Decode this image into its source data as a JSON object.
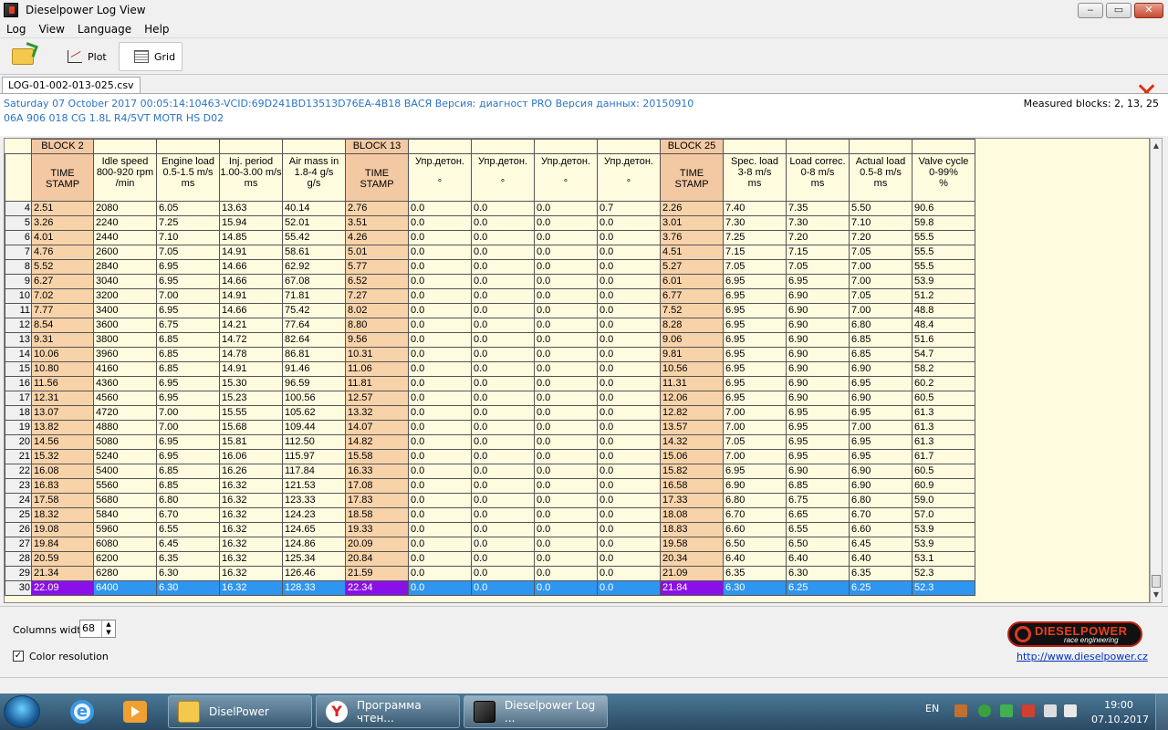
{
  "window": {
    "title": "Dieselpower Log View",
    "min_label": "‒",
    "max_label": "▭",
    "close_label": "✕"
  },
  "menu": [
    "Log",
    "View",
    "Language",
    "Help"
  ],
  "toolbar": {
    "plot_label": "Plot",
    "grid_label": "Grid"
  },
  "file_tab": "LOG-01-002-013-025.csv",
  "info": {
    "line1": "Saturday 07 October 2017 00:05:14:10463-VCID:69D241BD13513D76EA-4B18 ВАСЯ Версия: диагност PRO Версия данных: 20150910",
    "line2": "06A 906 018 CG  1.8L R4/5VT MOTR HS D02",
    "measured": "Measured blocks: 2, 13, 25"
  },
  "grid": {
    "blocks": [
      {
        "label": "BLOCK 2",
        "span": 5
      },
      {
        "label": "BLOCK 13",
        "span": 5
      },
      {
        "label": "BLOCK 25",
        "span": 5
      }
    ],
    "headers": [
      "TIME\nSTAMP",
      "Idle speed\n800-920 rpm\n/min",
      "Engine load\n0.5-1.5 m/s\nms",
      "Inj. period\n1.00-3.00 m/s\nms",
      "Air mass in\n1.8-4 g/s\ng/s",
      "TIME\nSTAMP",
      "Упр.детон.\n\n°",
      "Упр.детон.\n\n°",
      "Упр.детон.\n\n°",
      "Упр.детон.\n\n°",
      "TIME\nSTAMP",
      "Spec. load\n3-8 m/s\nms",
      "Load correc.\n0-8 m/s\nms",
      "Actual load\n0.5-8 m/s\nms",
      "Valve cycle\n0-99%\n%"
    ],
    "timestamp_cols": [
      0,
      5,
      10
    ],
    "selected_row": 30,
    "rows": [
      {
        "n": "4",
        "cells": [
          "2.51",
          "2080",
          "6.05",
          "13.63",
          "40.14",
          "2.76",
          "0.0",
          "0.0",
          "0.0",
          "0.7",
          "2.26",
          "7.40",
          "7.35",
          "5.50",
          "90.6"
        ]
      },
      {
        "n": "5",
        "cells": [
          "3.26",
          "2240",
          "7.25",
          "15.94",
          "52.01",
          "3.51",
          "0.0",
          "0.0",
          "0.0",
          "0.0",
          "3.01",
          "7.30",
          "7.30",
          "7.10",
          "59.8"
        ]
      },
      {
        "n": "6",
        "cells": [
          "4.01",
          "2440",
          "7.10",
          "14.85",
          "55.42",
          "4.26",
          "0.0",
          "0.0",
          "0.0",
          "0.0",
          "3.76",
          "7.25",
          "7.20",
          "7.20",
          "55.5"
        ]
      },
      {
        "n": "7",
        "cells": [
          "4.76",
          "2600",
          "7.05",
          "14.91",
          "58.61",
          "5.01",
          "0.0",
          "0.0",
          "0.0",
          "0.0",
          "4.51",
          "7.15",
          "7.15",
          "7.05",
          "55.5"
        ]
      },
      {
        "n": "8",
        "cells": [
          "5.52",
          "2840",
          "6.95",
          "14.66",
          "62.92",
          "5.77",
          "0.0",
          "0.0",
          "0.0",
          "0.0",
          "5.27",
          "7.05",
          "7.05",
          "7.00",
          "55.5"
        ]
      },
      {
        "n": "9",
        "cells": [
          "6.27",
          "3040",
          "6.95",
          "14.66",
          "67.08",
          "6.52",
          "0.0",
          "0.0",
          "0.0",
          "0.0",
          "6.01",
          "6.95",
          "6.95",
          "7.00",
          "53.9"
        ]
      },
      {
        "n": "10",
        "cells": [
          "7.02",
          "3200",
          "7.00",
          "14.91",
          "71.81",
          "7.27",
          "0.0",
          "0.0",
          "0.0",
          "0.0",
          "6.77",
          "6.95",
          "6.90",
          "7.05",
          "51.2"
        ]
      },
      {
        "n": "11",
        "cells": [
          "7.77",
          "3400",
          "6.95",
          "14.66",
          "75.42",
          "8.02",
          "0.0",
          "0.0",
          "0.0",
          "0.0",
          "7.52",
          "6.95",
          "6.90",
          "7.00",
          "48.8"
        ]
      },
      {
        "n": "12",
        "cells": [
          "8.54",
          "3600",
          "6.75",
          "14.21",
          "77.64",
          "8.80",
          "0.0",
          "0.0",
          "0.0",
          "0.0",
          "8.28",
          "6.95",
          "6.90",
          "6.80",
          "48.4"
        ]
      },
      {
        "n": "13",
        "cells": [
          "9.31",
          "3800",
          "6.85",
          "14.72",
          "82.64",
          "9.56",
          "0.0",
          "0.0",
          "0.0",
          "0.0",
          "9.06",
          "6.95",
          "6.90",
          "6.85",
          "51.6"
        ]
      },
      {
        "n": "14",
        "cells": [
          "10.06",
          "3960",
          "6.85",
          "14.78",
          "86.81",
          "10.31",
          "0.0",
          "0.0",
          "0.0",
          "0.0",
          "9.81",
          "6.95",
          "6.90",
          "6.85",
          "54.7"
        ]
      },
      {
        "n": "15",
        "cells": [
          "10.80",
          "4160",
          "6.85",
          "14.91",
          "91.46",
          "11.06",
          "0.0",
          "0.0",
          "0.0",
          "0.0",
          "10.56",
          "6.95",
          "6.90",
          "6.90",
          "58.2"
        ]
      },
      {
        "n": "16",
        "cells": [
          "11.56",
          "4360",
          "6.95",
          "15.30",
          "96.59",
          "11.81",
          "0.0",
          "0.0",
          "0.0",
          "0.0",
          "11.31",
          "6.95",
          "6.90",
          "6.95",
          "60.2"
        ]
      },
      {
        "n": "17",
        "cells": [
          "12.31",
          "4560",
          "6.95",
          "15.23",
          "100.56",
          "12.57",
          "0.0",
          "0.0",
          "0.0",
          "0.0",
          "12.06",
          "6.95",
          "6.90",
          "6.90",
          "60.5"
        ]
      },
      {
        "n": "18",
        "cells": [
          "13.07",
          "4720",
          "7.00",
          "15.55",
          "105.62",
          "13.32",
          "0.0",
          "0.0",
          "0.0",
          "0.0",
          "12.82",
          "7.00",
          "6.95",
          "6.95",
          "61.3"
        ]
      },
      {
        "n": "19",
        "cells": [
          "13.82",
          "4880",
          "7.00",
          "15.68",
          "109.44",
          "14.07",
          "0.0",
          "0.0",
          "0.0",
          "0.0",
          "13.57",
          "7.00",
          "6.95",
          "7.00",
          "61.3"
        ]
      },
      {
        "n": "20",
        "cells": [
          "14.56",
          "5080",
          "6.95",
          "15.81",
          "112.50",
          "14.82",
          "0.0",
          "0.0",
          "0.0",
          "0.0",
          "14.32",
          "7.05",
          "6.95",
          "6.95",
          "61.3"
        ]
      },
      {
        "n": "21",
        "cells": [
          "15.32",
          "5240",
          "6.95",
          "16.06",
          "115.97",
          "15.58",
          "0.0",
          "0.0",
          "0.0",
          "0.0",
          "15.06",
          "7.00",
          "6.95",
          "6.95",
          "61.7"
        ]
      },
      {
        "n": "22",
        "cells": [
          "16.08",
          "5400",
          "6.85",
          "16.26",
          "117.84",
          "16.33",
          "0.0",
          "0.0",
          "0.0",
          "0.0",
          "15.82",
          "6.95",
          "6.90",
          "6.90",
          "60.5"
        ]
      },
      {
        "n": "23",
        "cells": [
          "16.83",
          "5560",
          "6.85",
          "16.32",
          "121.53",
          "17.08",
          "0.0",
          "0.0",
          "0.0",
          "0.0",
          "16.58",
          "6.90",
          "6.85",
          "6.90",
          "60.9"
        ]
      },
      {
        "n": "24",
        "cells": [
          "17.58",
          "5680",
          "6.80",
          "16.32",
          "123.33",
          "17.83",
          "0.0",
          "0.0",
          "0.0",
          "0.0",
          "17.33",
          "6.80",
          "6.75",
          "6.80",
          "59.0"
        ]
      },
      {
        "n": "25",
        "cells": [
          "18.32",
          "5840",
          "6.70",
          "16.32",
          "124.23",
          "18.58",
          "0.0",
          "0.0",
          "0.0",
          "0.0",
          "18.08",
          "6.70",
          "6.65",
          "6.70",
          "57.0"
        ]
      },
      {
        "n": "26",
        "cells": [
          "19.08",
          "5960",
          "6.55",
          "16.32",
          "124.65",
          "19.33",
          "0.0",
          "0.0",
          "0.0",
          "0.0",
          "18.83",
          "6.60",
          "6.55",
          "6.60",
          "53.9"
        ]
      },
      {
        "n": "27",
        "cells": [
          "19.84",
          "6080",
          "6.45",
          "16.32",
          "124.86",
          "20.09",
          "0.0",
          "0.0",
          "0.0",
          "0.0",
          "19.58",
          "6.50",
          "6.50",
          "6.45",
          "53.9"
        ]
      },
      {
        "n": "28",
        "cells": [
          "20.59",
          "6200",
          "6.35",
          "16.32",
          "125.34",
          "20.84",
          "0.0",
          "0.0",
          "0.0",
          "0.0",
          "20.34",
          "6.40",
          "6.40",
          "6.40",
          "53.1"
        ]
      },
      {
        "n": "29",
        "cells": [
          "21.34",
          "6280",
          "6.30",
          "16.32",
          "126.46",
          "21.59",
          "0.0",
          "0.0",
          "0.0",
          "0.0",
          "21.09",
          "6.35",
          "6.30",
          "6.35",
          "52.3"
        ]
      },
      {
        "n": "30",
        "cells": [
          "22.09",
          "6400",
          "6.30",
          "16.32",
          "128.33",
          "22.34",
          "0.0",
          "0.0",
          "0.0",
          "0.0",
          "21.84",
          "6.30",
          "6.25",
          "6.25",
          "52.3"
        ]
      }
    ]
  },
  "bottom": {
    "columns_width_label": "Columns width:",
    "columns_width_value": "68",
    "color_resolution_label": "Color resolution",
    "color_resolution_checked": true,
    "logo_name": "DIESELPOWER",
    "logo_sub": "race engineering",
    "url": "http://www.dieselpower.cz"
  },
  "taskbar": {
    "tasks": [
      {
        "label": "DiselPower",
        "icon": "folder-icon"
      },
      {
        "label": "Программа чтен...",
        "icon": "yandex-browser-icon"
      },
      {
        "label": "Dieselpower Log ...",
        "icon": "dieselpower-app-icon",
        "active": true
      }
    ],
    "lang": "EN",
    "time": "19:00",
    "date": "07.10.2017"
  },
  "colors": {
    "info_text": "#2a74c8",
    "timestamp_bg": "#f8d3aa",
    "grid_bg": "#fffbdf",
    "selected_row": "#2e95f0",
    "selected_timestamp": "#8a10e8",
    "close_x": "#e03010"
  }
}
